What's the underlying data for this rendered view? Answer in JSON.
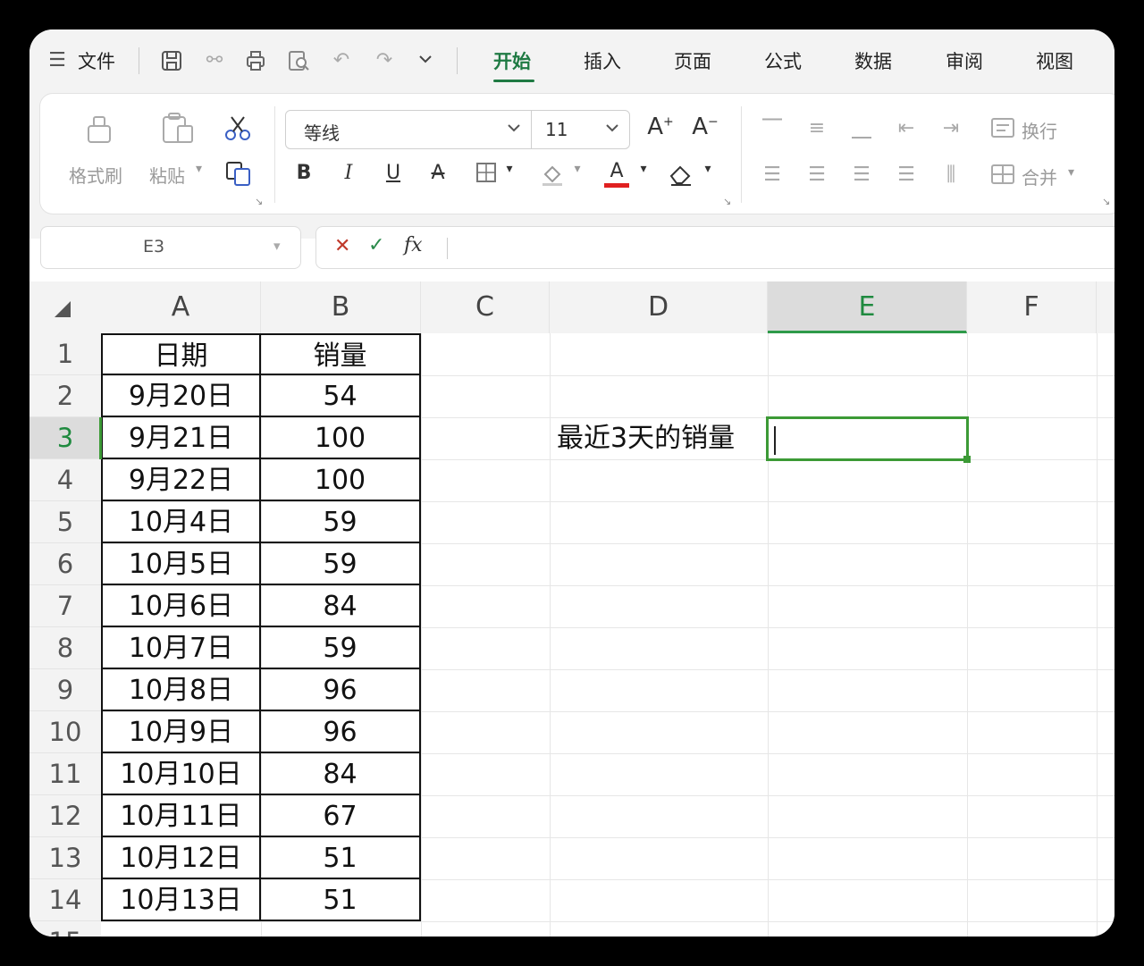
{
  "menu": {
    "file_label": "文件",
    "tabs": [
      {
        "label": "开始",
        "active": true
      },
      {
        "label": "插入",
        "active": false
      },
      {
        "label": "页面",
        "active": false
      },
      {
        "label": "公式",
        "active": false
      },
      {
        "label": "数据",
        "active": false
      },
      {
        "label": "审阅",
        "active": false
      },
      {
        "label": "视图",
        "active": false
      }
    ]
  },
  "ribbon": {
    "format_painter": "格式刷",
    "paste": "粘贴",
    "font_name": "等线",
    "font_size": "11",
    "wrap": "换行",
    "merge": "合并"
  },
  "formula_bar": {
    "name_box": "E3",
    "fx": "fx",
    "content": ""
  },
  "sheet": {
    "columns": [
      "A",
      "B",
      "C",
      "D",
      "E",
      "F"
    ],
    "selected_column": "E",
    "selected_row": 3,
    "rows": [
      "1",
      "2",
      "3",
      "4",
      "5",
      "6",
      "7",
      "8",
      "9",
      "10",
      "11",
      "12",
      "13",
      "14",
      "15"
    ],
    "table": [
      [
        "日期",
        "销量"
      ],
      [
        "9月20日",
        "54"
      ],
      [
        "9月21日",
        "100"
      ],
      [
        "9月22日",
        "100"
      ],
      [
        "10月4日",
        "59"
      ],
      [
        "10月5日",
        "59"
      ],
      [
        "10月6日",
        "84"
      ],
      [
        "10月7日",
        "59"
      ],
      [
        "10月8日",
        "96"
      ],
      [
        "10月9日",
        "96"
      ],
      [
        "10月10日",
        "84"
      ],
      [
        "10月11日",
        "67"
      ],
      [
        "10月12日",
        "51"
      ],
      [
        "10月13日",
        "51"
      ]
    ],
    "d3_label": "最近3天的销量"
  },
  "colors": {
    "accent": "#1f7a43",
    "selection": "#3c9a36",
    "font_color_bar": "#e02020"
  }
}
